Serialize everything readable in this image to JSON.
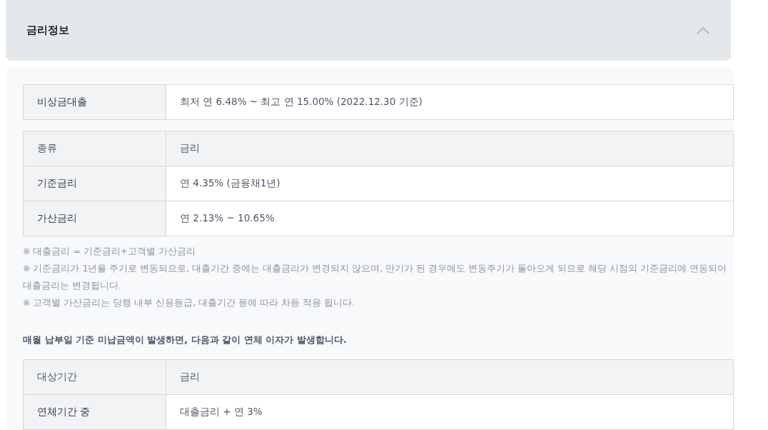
{
  "section": {
    "title": "금리정보",
    "expanded": true
  },
  "rate_summary": {
    "label": "비상금대출",
    "value": "최저 연 6.48% ~ 최고 연 15.00% (2022.12.30 기준)"
  },
  "rate_table": {
    "columns": [
      "종류",
      "금리"
    ],
    "rows": [
      [
        "기준금리",
        "연 4.35% (금융채1년)"
      ],
      [
        "가산금리",
        "연 2.13% ~ 10.65%"
      ]
    ]
  },
  "notes": [
    "※ 대출금리 = 기준금리+고객별 가산금리",
    "※ 기준금리가 1년을 주기로 변동되므로, 대출기간 중에는 대출금리가 변경되지 않으며, 만기가 된 경우에도 변동주기가 돌아오게 되므로 해당 시점의 기준금리에 연동되어 대출금리는 변경됩니다.",
    "※ 고객별 가산금리는 당행 내부 신용등급, 대출기간 등에 따라 차등 적용 됩니다."
  ],
  "overdue_notice": "매월 납부일 기준 미납금액이 발생하면, 다음과 같이 연체 이자가 발생합니다.",
  "overdue_table": {
    "columns": [
      "대상기간",
      "금리"
    ],
    "rows": [
      [
        "연체기간 중",
        "대출금리 + 연 3%"
      ]
    ]
  }
}
